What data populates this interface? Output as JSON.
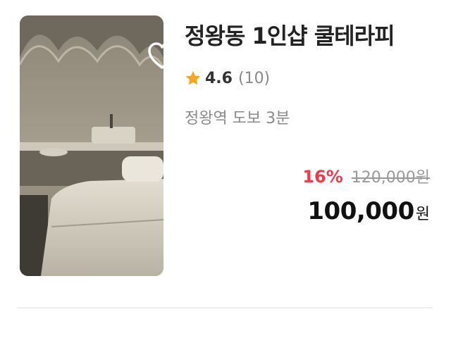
{
  "product": {
    "title": "정왕동 1인샵 쿨테라피",
    "rating": "4.6",
    "review_count": "(10)",
    "location": "정왕역 도보 3분",
    "discount": "16%",
    "original_price": "120,000원",
    "final_price": "100,000",
    "currency": "원",
    "favorited": false
  },
  "icons": {
    "favorite": "heart-outline-icon",
    "rating": "star-icon"
  },
  "colors": {
    "discount": "#ef3a4a",
    "star": "#f6a623"
  }
}
